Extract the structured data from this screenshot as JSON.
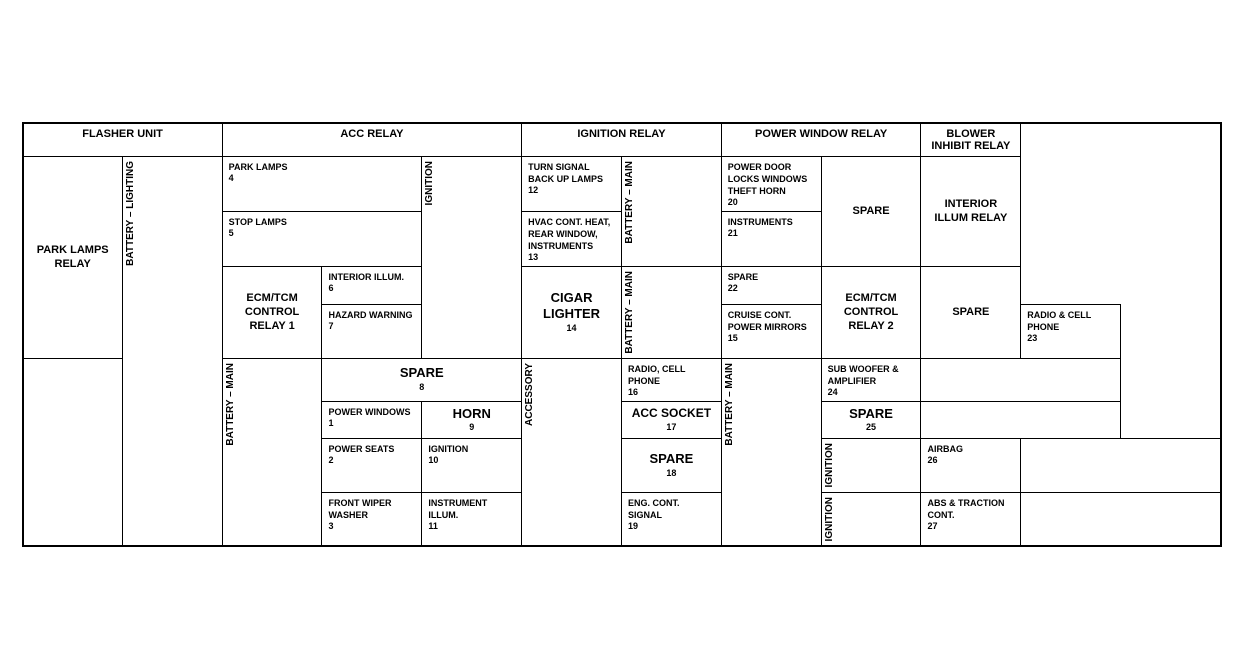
{
  "headers": {
    "flasher_unit": "FLASHER UNIT",
    "acc_relay": "ACC RELAY",
    "ignition_relay": "IGNITION RELAY",
    "power_window_relay": "POWER WINDOW RELAY",
    "blower_inhibit_relay": "BLOWER INHIBIT RELAY"
  },
  "left_labels": {
    "park_lamps_relay": "PARK LAMPS RELAY",
    "ecm_tcm_1": "ECM/TCM CONTROL RELAY 1",
    "empty": ""
  },
  "battery_lighting_label": "BATTERY – LIGHTING",
  "ignition_label": "IGNITION",
  "battery_main_label": "BATTERY – MAIN",
  "accessory_label": "ACCESSORY",
  "battery_main2_label": "BATTERY – MAIN",
  "ignition2_label": "IGNITION",
  "fuses": {
    "f4": {
      "num": "4",
      "label": "PARK LAMPS"
    },
    "f5": {
      "num": "5",
      "label": "STOP LAMPS"
    },
    "f6": {
      "num": "6",
      "label": "INTERIOR ILLUM."
    },
    "f7": {
      "num": "7",
      "label": "HAZARD WARNING"
    },
    "f8": {
      "num": "8",
      "label": "SPARE"
    },
    "f9": {
      "num": "9",
      "label": "HORN"
    },
    "f10": {
      "num": "10",
      "label": "IGNITION"
    },
    "f11": {
      "num": "11",
      "label": "INSTRUMENT ILLUM."
    },
    "f1": {
      "num": "1",
      "label": "POWER WINDOWS"
    },
    "f2": {
      "num": "2",
      "label": "POWER SEATS"
    },
    "f3": {
      "num": "3",
      "label": "FRONT WIPER WASHER"
    },
    "f12": {
      "num": "12",
      "label": "TURN SIGNAL BACK UP LAMPS"
    },
    "f13": {
      "num": "13",
      "label": "HVAC CONT. HEAT, REAR WINDOW, INSTRUMENTS"
    },
    "f14": {
      "num": "14",
      "label": "CIGAR LIGHTER"
    },
    "f15": {
      "num": "15",
      "label": "CRUISE CONT. POWER MIRRORS"
    },
    "f16": {
      "num": "16",
      "label": "RADIO, CELL PHONE"
    },
    "f17": {
      "num": "17",
      "label": "ACC SOCKET"
    },
    "f18": {
      "num": "18",
      "label": "SPARE"
    },
    "f19": {
      "num": "19",
      "label": "ENG. CONT. SIGNAL"
    },
    "f20": {
      "num": "20",
      "label": "POWER DOOR LOCKS WINDOWS THEFT HORN"
    },
    "f21": {
      "num": "21",
      "label": "INSTRUMENTS"
    },
    "f22": {
      "num": "22",
      "label": "SPARE"
    },
    "f23": {
      "num": "23",
      "label": "RADIO & CELL PHONE"
    },
    "f24": {
      "num": "24",
      "label": "SUB WOOFER & AMPLIFIER"
    },
    "f25": {
      "num": "25",
      "label": "SPARE"
    },
    "f26": {
      "num": "26",
      "label": "AIRBAG"
    },
    "f27": {
      "num": "27",
      "label": "ABS & TRACTION CONT."
    }
  },
  "right_labels": {
    "spare1": "SPARE",
    "interior_illum_relay": "INTERIOR ILLUM RELAY",
    "ecm_tcm_2": "ECM/TCM CONTROL RELAY 2",
    "spare2": "SPARE"
  }
}
